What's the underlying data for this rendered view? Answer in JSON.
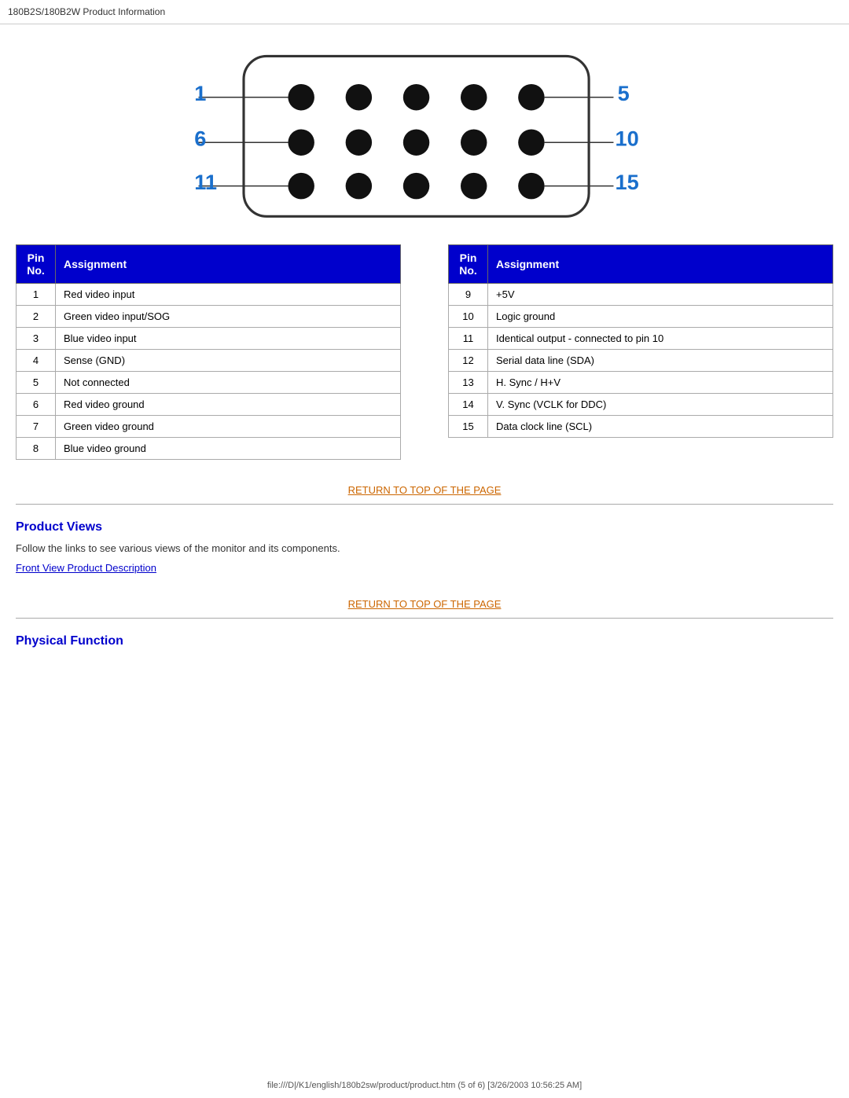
{
  "page": {
    "title": "180B2S/180B2W Product Information",
    "footer": "file:///D|/K1/english/180b2sw/product/product.htm (5 of 6) [3/26/2003 10:56:25 AM]"
  },
  "connector": {
    "pin_labels_left": [
      "1",
      "6",
      "11"
    ],
    "pin_labels_right": [
      "5",
      "10",
      "15"
    ]
  },
  "table_left": {
    "col1_header": "Pin No.",
    "col2_header": "Assignment",
    "rows": [
      {
        "pin": "1",
        "assignment": "Red video input"
      },
      {
        "pin": "2",
        "assignment": "Green video input/SOG"
      },
      {
        "pin": "3",
        "assignment": "Blue video input"
      },
      {
        "pin": "4",
        "assignment": "Sense (GND)"
      },
      {
        "pin": "5",
        "assignment": "Not connected"
      },
      {
        "pin": "6",
        "assignment": "Red video ground"
      },
      {
        "pin": "7",
        "assignment": "Green video ground"
      },
      {
        "pin": "8",
        "assignment": "Blue video ground"
      }
    ]
  },
  "table_right": {
    "col1_header": "Pin No.",
    "col2_header": "Assignment",
    "rows": [
      {
        "pin": "9",
        "assignment": "+5V"
      },
      {
        "pin": "10",
        "assignment": "Logic ground"
      },
      {
        "pin": "11",
        "assignment": "Identical output - connected to pin 10"
      },
      {
        "pin": "12",
        "assignment": "Serial data line (SDA)"
      },
      {
        "pin": "13",
        "assignment": "H. Sync / H+V"
      },
      {
        "pin": "14",
        "assignment": "V. Sync (VCLK for DDC)"
      },
      {
        "pin": "15",
        "assignment": "Data clock line (SCL)"
      }
    ]
  },
  "return_link": {
    "label": "RETURN TO TOP OF THE PAGE"
  },
  "product_views": {
    "heading": "Product Views",
    "body": "Follow the links to see various views of the monitor and its components.",
    "link_label": "Front View Product Description"
  },
  "physical_function": {
    "heading": "Physical Function"
  }
}
